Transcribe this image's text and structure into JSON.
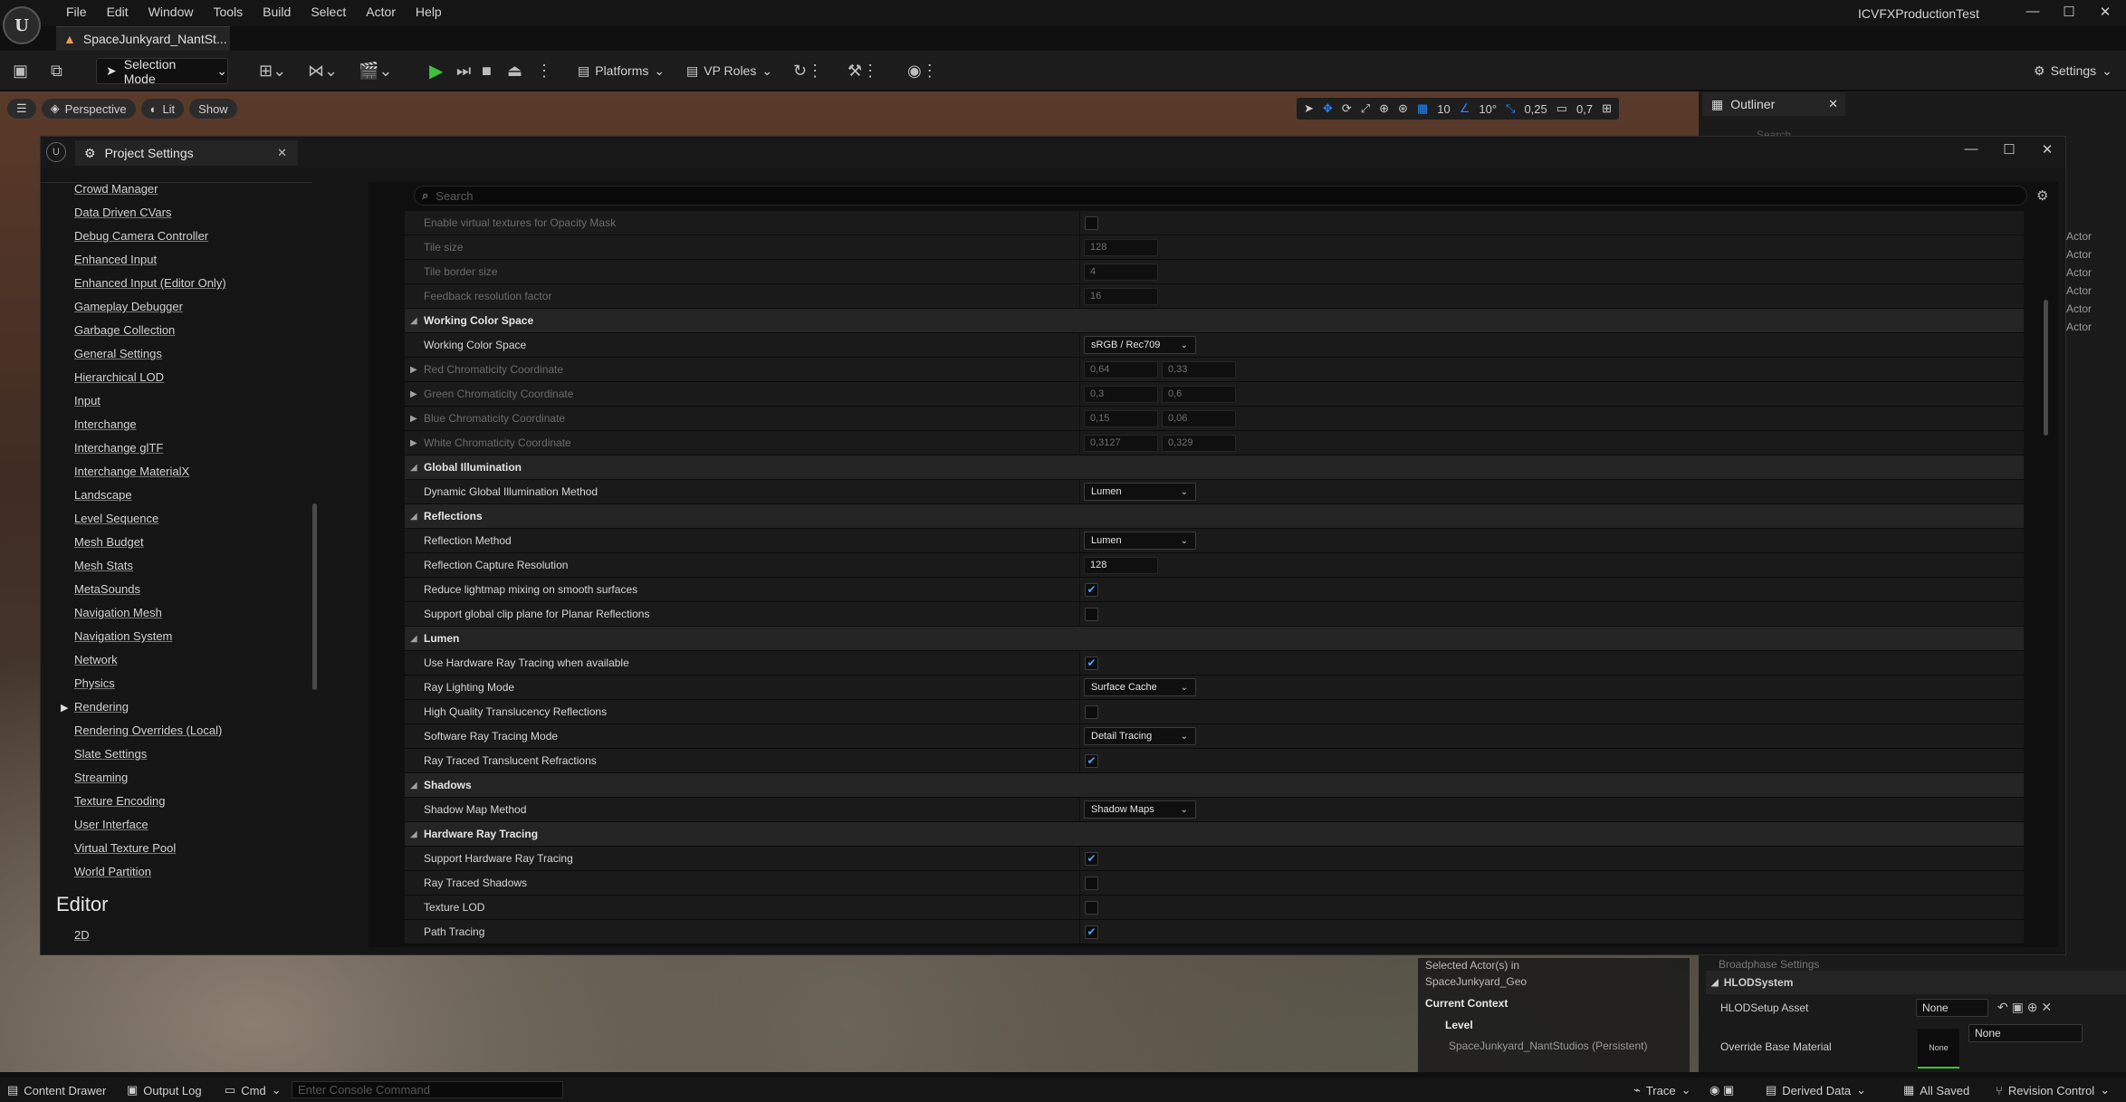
{
  "menubar": {
    "logo": "U",
    "items": [
      "File",
      "Edit",
      "Window",
      "Tools",
      "Build",
      "Select",
      "Actor",
      "Help"
    ],
    "app_title": "ICVFXProductionTest",
    "minimize": "—",
    "maximize": "☐",
    "close": "✕"
  },
  "level_tab": {
    "label": "SpaceJunkyard_NantSt..."
  },
  "toolbar": {
    "selection_mode": "Selection Mode",
    "platforms": "Platforms",
    "vp_roles": "VP Roles",
    "settings": "Settings"
  },
  "viewport": {
    "perspective": "Perspective",
    "lit": "Lit",
    "show": "Show",
    "grid_snap": "10",
    "rot_snap": "10°",
    "scale_snap": "0,25",
    "cam_speed": "0,7"
  },
  "outliner": {
    "title": "Outliner",
    "search_placeholder": "Search",
    "actor_labels": [
      "Actor",
      "Actor",
      "Actor",
      "Actor",
      "Actor",
      "Actor"
    ]
  },
  "details": {
    "broadphase": "Broadphase Settings",
    "hlod_section": "HLODSystem",
    "hlod_setup_label": "HLODSetup Asset",
    "hlod_setup_value": "None",
    "override_label": "Override Base Material",
    "override_value": "None",
    "override_thumb": "None"
  },
  "context": {
    "selected_line1": "Selected Actor(s) in",
    "selected_line2": "SpaceJunkyard_Geo",
    "current_context": "Current Context",
    "level": "Level",
    "level_name": "SpaceJunkyard_NantStudios (Persistent)"
  },
  "statusbar": {
    "content_drawer": "Content Drawer",
    "output_log": "Output Log",
    "cmd": "Cmd",
    "console_placeholder": "Enter Console Command",
    "trace": "Trace",
    "derived_data": "Derived Data",
    "all_saved": "All Saved",
    "revision_control": "Revision Control"
  },
  "project_settings": {
    "tab_title": "Project Settings",
    "search_placeholder": "Search",
    "sidebar_items": [
      "Crowd Manager",
      "Data Driven CVars",
      "Debug Camera Controller",
      "Enhanced Input",
      "Enhanced Input (Editor Only)",
      "Gameplay Debugger",
      "Garbage Collection",
      "General Settings",
      "Hierarchical LOD",
      "Input",
      "Interchange",
      "Interchange glTF",
      "Interchange MaterialX",
      "Landscape",
      "Level Sequence",
      "Mesh Budget",
      "Mesh Stats",
      "MetaSounds",
      "Navigation Mesh",
      "Navigation System",
      "Network",
      "Physics",
      "Rendering",
      "Rendering Overrides (Local)",
      "Slate Settings",
      "Streaming",
      "Texture Encoding",
      "User Interface",
      "Virtual Texture Pool",
      "World Partition"
    ],
    "editor_heading": "Editor",
    "editor_first_item": "2D",
    "rows": [
      {
        "type": "check",
        "label": "Enable virtual textures for Opacity Mask",
        "dim": true,
        "checked": false
      },
      {
        "type": "value",
        "label": "Tile size",
        "dim": true,
        "values": [
          "128"
        ]
      },
      {
        "type": "value",
        "label": "Tile border size",
        "dim": true,
        "values": [
          "4"
        ]
      },
      {
        "type": "value",
        "label": "Feedback resolution factor",
        "dim": true,
        "values": [
          "16"
        ]
      },
      {
        "type": "section",
        "label": "Working Color Space"
      },
      {
        "type": "dropdown",
        "label": "Working Color Space",
        "value": "sRGB / Rec709"
      },
      {
        "type": "value",
        "label": "Red Chromaticity Coordinate",
        "dim": true,
        "twist": true,
        "values": [
          "0,64",
          "0,33"
        ]
      },
      {
        "type": "value",
        "label": "Green Chromaticity Coordinate",
        "dim": true,
        "twist": true,
        "values": [
          "0,3",
          "0,6"
        ]
      },
      {
        "type": "value",
        "label": "Blue Chromaticity Coordinate",
        "dim": true,
        "twist": true,
        "values": [
          "0,15",
          "0,06"
        ]
      },
      {
        "type": "value",
        "label": "White Chromaticity Coordinate",
        "dim": true,
        "twist": true,
        "values": [
          "0,3127",
          "0,329"
        ]
      },
      {
        "type": "section",
        "label": "Global Illumination"
      },
      {
        "type": "dropdown",
        "label": "Dynamic Global Illumination Method",
        "value": "Lumen"
      },
      {
        "type": "section",
        "label": "Reflections"
      },
      {
        "type": "dropdown",
        "label": "Reflection Method",
        "value": "Lumen"
      },
      {
        "type": "value",
        "label": "Reflection Capture Resolution",
        "values": [
          "128"
        ]
      },
      {
        "type": "check",
        "label": "Reduce lightmap mixing on smooth surfaces",
        "checked": true
      },
      {
        "type": "check",
        "label": "Support global clip plane for Planar Reflections",
        "checked": false
      },
      {
        "type": "section",
        "label": "Lumen"
      },
      {
        "type": "check",
        "label": "Use Hardware Ray Tracing when available",
        "checked": true
      },
      {
        "type": "dropdown",
        "label": "Ray Lighting Mode",
        "value": "Surface Cache"
      },
      {
        "type": "check",
        "label": "High Quality Translucency Reflections",
        "checked": false
      },
      {
        "type": "dropdown",
        "label": "Software Ray Tracing Mode",
        "value": "Detail Tracing"
      },
      {
        "type": "check",
        "label": "Ray Traced Translucent Refractions",
        "checked": true
      },
      {
        "type": "section",
        "label": "Shadows"
      },
      {
        "type": "dropdown",
        "label": "Shadow Map Method",
        "value": "Shadow Maps"
      },
      {
        "type": "section",
        "label": "Hardware Ray Tracing"
      },
      {
        "type": "check",
        "label": "Support Hardware Ray Tracing",
        "checked": true
      },
      {
        "type": "check",
        "label": "Ray Traced Shadows",
        "checked": false
      },
      {
        "type": "check",
        "label": "Texture LOD",
        "checked": false
      },
      {
        "type": "check",
        "label": "Path Tracing",
        "checked": true
      }
    ]
  },
  "icons": {
    "check_mark": "✔",
    "chevron": "⌄",
    "triangle_down": "◢",
    "triangle_right": "▶",
    "search": "⌕",
    "gear": "⚙"
  },
  "colors": {
    "accent_blue": "#1e8cff",
    "play_green": "#3cc23c",
    "level_icon": "#e2a54a"
  }
}
